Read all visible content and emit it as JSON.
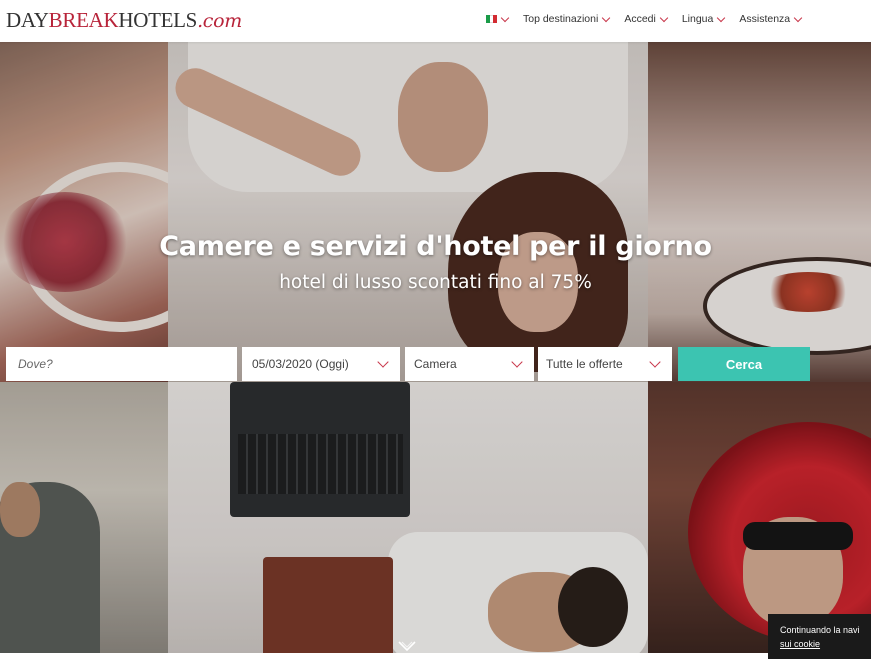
{
  "logo": {
    "part1": "DAY",
    "part2": "BREAK",
    "part3": "HOTELS",
    "part4": ".com"
  },
  "nav": {
    "language_flag": "italy-flag-icon",
    "items": [
      {
        "label": "Top destinazioni"
      },
      {
        "label": "Accedi"
      },
      {
        "label": "Lingua"
      },
      {
        "label": "Assistenza"
      }
    ]
  },
  "hero": {
    "title": "Camere e servizi d'hotel per il giorno",
    "subtitle": "hotel di lusso scontati fino al 75%"
  },
  "search": {
    "where_placeholder": "Dove?",
    "date_value": "05/03/2020 (Oggi)",
    "room_value": "Camera",
    "offers_value": "Tutte le offerte",
    "submit_label": "Cerca"
  },
  "cookie": {
    "text": "Continuando la navi",
    "link": "sui cookie"
  },
  "colors": {
    "accent": "#c8364a",
    "button": "#3cc4b1",
    "brand_red": "#b8243a"
  }
}
